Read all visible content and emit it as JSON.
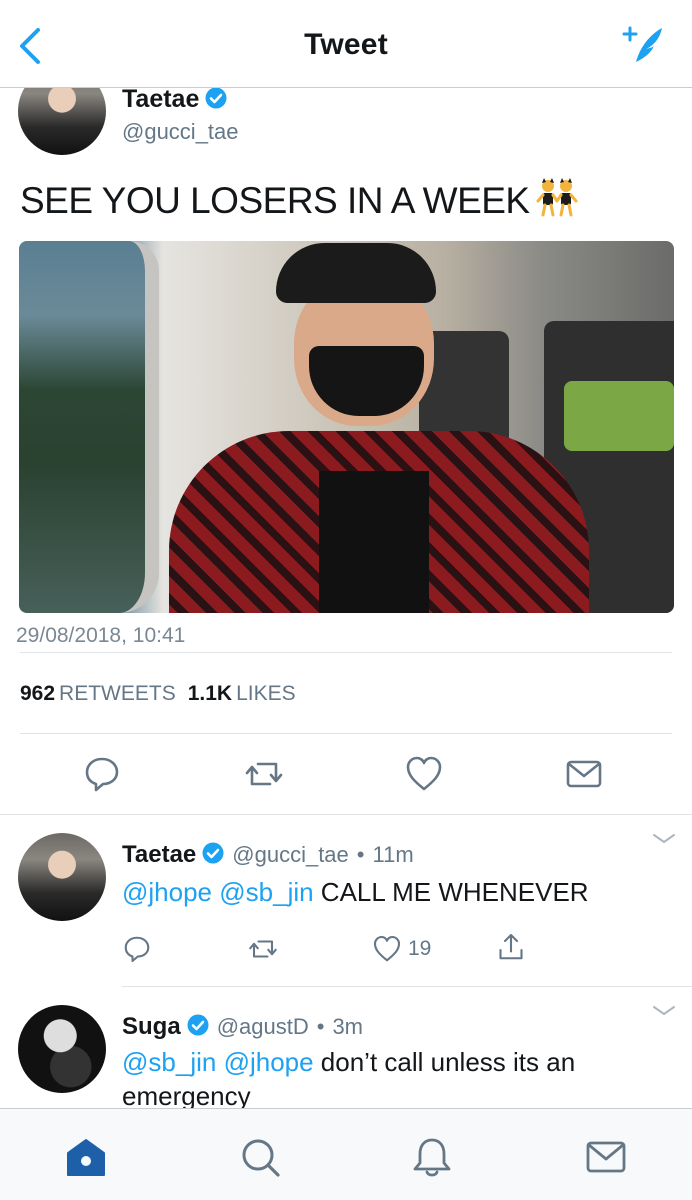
{
  "header": {
    "title": "Tweet"
  },
  "main_tweet": {
    "author_name": "Taetae",
    "author_handle": "@gucci_tae",
    "text": "SEE YOU LOSERS IN A WEEK",
    "emoji": "dancers-emoji",
    "timestamp": "29/08/2018, 10:41",
    "retweets_count": "962",
    "retweets_label": "RETWEETS",
    "likes_count": "1.1K",
    "likes_label": "LIKES"
  },
  "replies": [
    {
      "name": "Taetae",
      "handle": "@gucci_tae",
      "separator": "•",
      "time": "11m",
      "mention1": "@jhope",
      "mention2": "@sb_jin",
      "text": " CALL ME WHENEVER",
      "likes": "19"
    },
    {
      "name": "Suga",
      "handle": "@agustD",
      "separator": "•",
      "time": "3m",
      "mention1": "@sb_jin",
      "mention2": "@jhope",
      "text": " don’t call unless its an emergency"
    }
  ],
  "tabbar": {
    "items": [
      "home-icon",
      "search-icon",
      "notifications-icon",
      "messages-icon"
    ]
  },
  "colors": {
    "accent": "#1da1f2",
    "text": "#14171a",
    "secondary": "#657786",
    "icon": "#657786",
    "home_active": "#1d5fa8"
  }
}
